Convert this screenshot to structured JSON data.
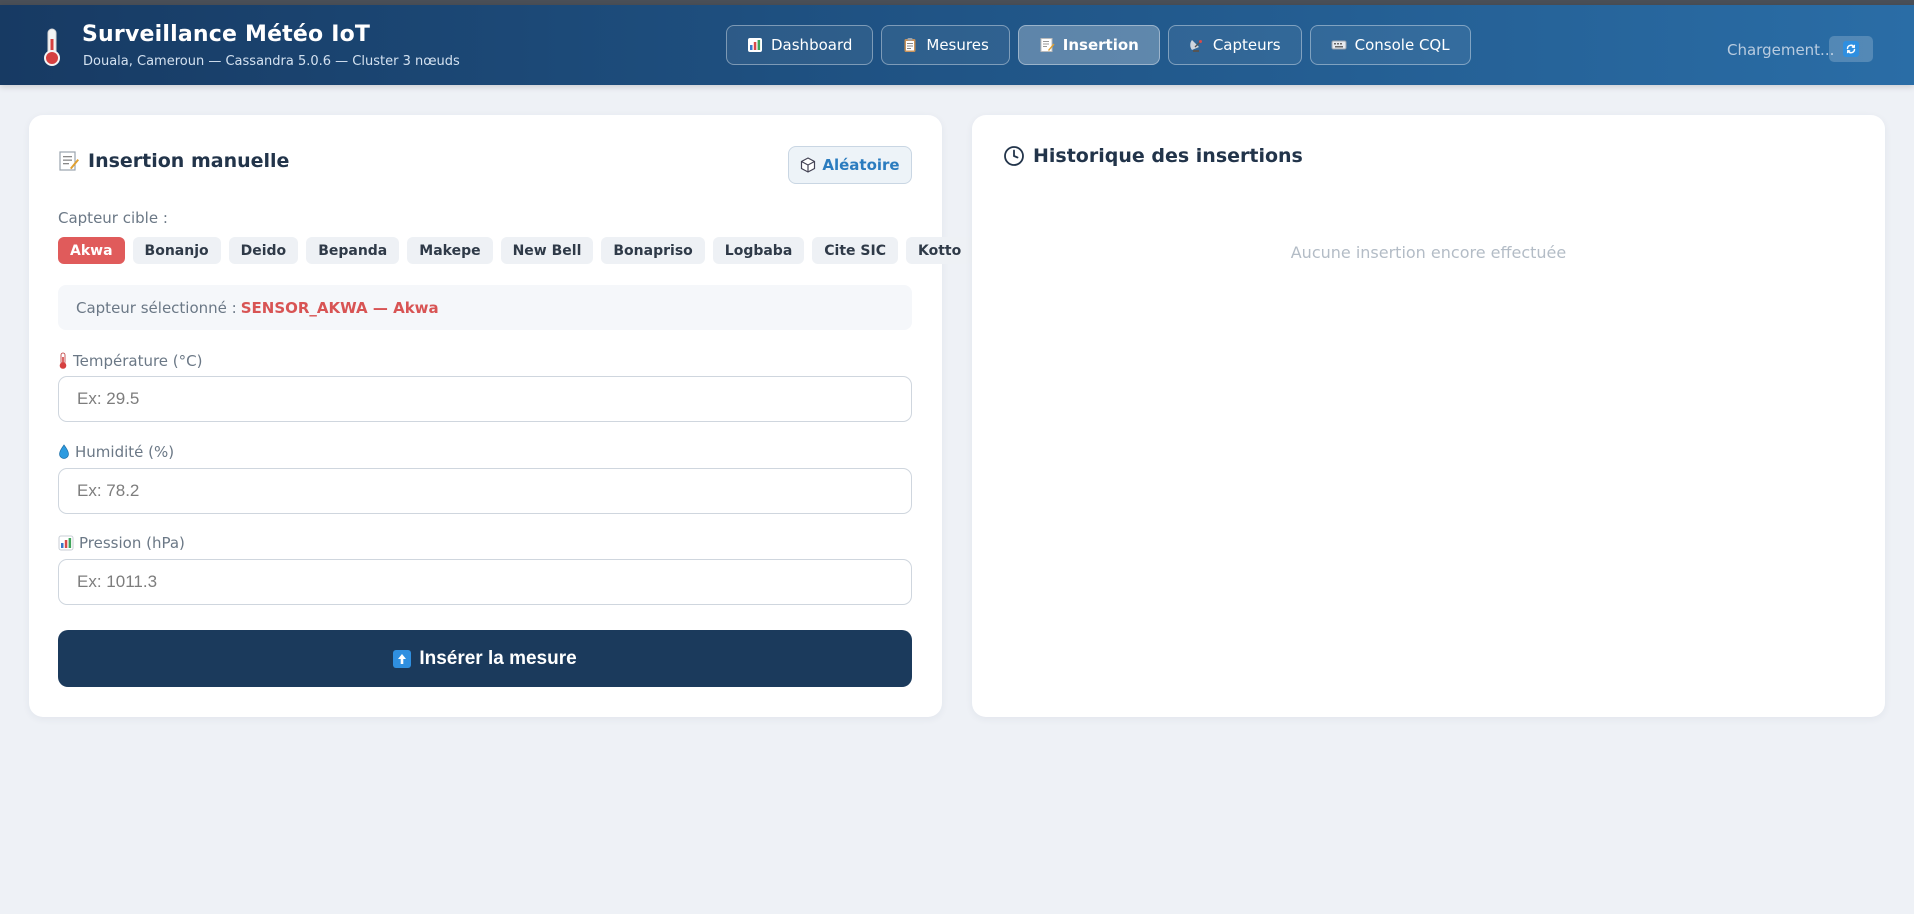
{
  "header": {
    "title": "Surveillance Météo IoT",
    "subtitle": "Douala, Cameroun — Cassandra 5.0.6 — Cluster 3 nœuds",
    "status_text": "Chargement...",
    "icon": "thermometer-icon"
  },
  "nav": [
    {
      "label": "Dashboard",
      "icon": "chart-icon",
      "active": false
    },
    {
      "label": "Mesures",
      "icon": "clipboard-icon",
      "active": false
    },
    {
      "label": "Insertion",
      "icon": "memo-icon",
      "active": true
    },
    {
      "label": "Capteurs",
      "icon": "satellite-icon",
      "active": false
    },
    {
      "label": "Console CQL",
      "icon": "keyboard-icon",
      "active": false
    }
  ],
  "insertion": {
    "title": "Insertion manuelle",
    "random_label": "Aléatoire",
    "target_label": "Capteur cible :",
    "sensors": [
      "Akwa",
      "Bonanjo",
      "Deido",
      "Bepanda",
      "Makepe",
      "New Bell",
      "Bonapriso",
      "Logbaba",
      "Cite SIC",
      "Kotto"
    ],
    "selected_sensor_index": 0,
    "selected_label": "Capteur sélectionné :",
    "selected_value": "SENSOR_AKWA — Akwa",
    "temperature": {
      "label": "Température (°C)",
      "value": "",
      "placeholder": "Ex: 29.5"
    },
    "humidity": {
      "label": "Humidité (%)",
      "value": "",
      "placeholder": "Ex: 78.2"
    },
    "pressure": {
      "label": "Pression (hPa)",
      "value": "",
      "placeholder": "Ex: 1011.3"
    },
    "submit_label": "Insérer la mesure"
  },
  "history": {
    "title": "Historique des insertions",
    "empty_text": "Aucune insertion encore effectuée"
  },
  "colors": {
    "header_dark": "#173a63",
    "header_light": "#2a6da6",
    "accent_red": "#e05b5b",
    "button_navy": "#1b3a5c",
    "link_blue": "#2b7cbf"
  }
}
